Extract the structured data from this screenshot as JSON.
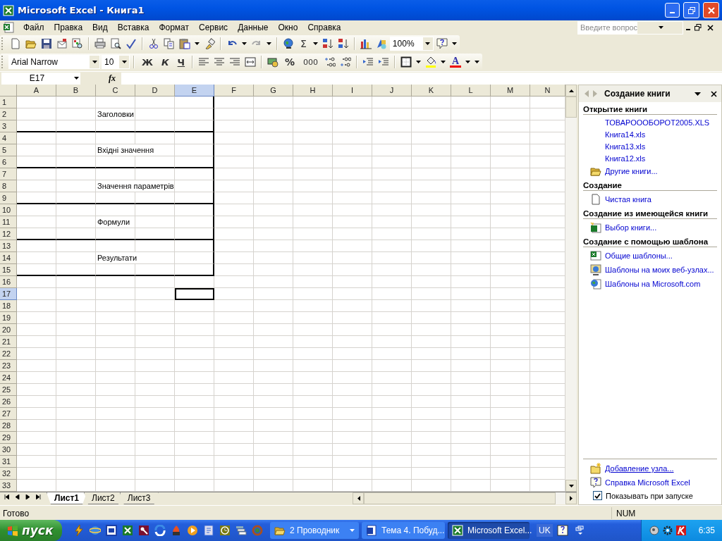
{
  "window": {
    "title": "Microsoft Excel - Книга1"
  },
  "menu": [
    "Файл",
    "Правка",
    "Вид",
    "Вставка",
    "Формат",
    "Сервис",
    "Данные",
    "Окно",
    "Справка"
  ],
  "help_box": {
    "placeholder": "Введите вопрос"
  },
  "standard_toolbar": {
    "sum_glyph": "Σ",
    "zoom": "100%"
  },
  "formatting_toolbar": {
    "font": "Arial Narrow",
    "size": "10",
    "bold": "Ж",
    "italic": "К",
    "underline": "Ч",
    "percent": "%",
    "thousands": "000",
    "font_color_glyph": "A"
  },
  "formula_bar": {
    "name_box": "E17",
    "function_glyph": "fx"
  },
  "sheet": {
    "columns": [
      {
        "label": "A",
        "selected": false,
        "outlined": true
      },
      {
        "label": "B",
        "selected": false,
        "outlined": true
      },
      {
        "label": "C",
        "selected": false,
        "outlined": true
      },
      {
        "label": "D",
        "selected": false,
        "outlined": true
      },
      {
        "label": "E",
        "selected": true,
        "outlined": true
      },
      {
        "label": "F",
        "selected": false,
        "outlined": false
      },
      {
        "label": "G",
        "selected": false,
        "outlined": false
      },
      {
        "label": "H",
        "selected": false,
        "outlined": false
      },
      {
        "label": "I",
        "selected": false,
        "outlined": false
      },
      {
        "label": "J",
        "selected": false,
        "outlined": false
      },
      {
        "label": "K",
        "selected": false,
        "outlined": false
      },
      {
        "label": "L",
        "selected": false,
        "outlined": false
      },
      {
        "label": "M",
        "selected": false,
        "outlined": false
      },
      {
        "label": "N",
        "selected": false,
        "outlined": false
      }
    ],
    "rows": [
      {
        "label": "1",
        "selected": false,
        "border_right": true,
        "border_bottom": false
      },
      {
        "label": "2",
        "selected": false,
        "border_right": true,
        "border_bottom": false,
        "cell_c": "Заголовки"
      },
      {
        "label": "3",
        "selected": false,
        "border_right": true,
        "border_bottom": true
      },
      {
        "label": "4",
        "selected": false,
        "border_right": true,
        "border_bottom": false
      },
      {
        "label": "5",
        "selected": false,
        "border_right": true,
        "border_bottom": false,
        "cell_c": "Вхідні значення"
      },
      {
        "label": "6",
        "selected": false,
        "border_right": true,
        "border_bottom": true
      },
      {
        "label": "7",
        "selected": false,
        "border_right": true,
        "border_bottom": false
      },
      {
        "label": "8",
        "selected": false,
        "border_right": true,
        "border_bottom": false,
        "cell_c": "Значення параметрів"
      },
      {
        "label": "9",
        "selected": false,
        "border_right": true,
        "border_bottom": true
      },
      {
        "label": "10",
        "selected": false,
        "border_right": true,
        "border_bottom": false
      },
      {
        "label": "11",
        "selected": false,
        "border_right": true,
        "border_bottom": false,
        "cell_c": "Формули"
      },
      {
        "label": "12",
        "selected": false,
        "border_right": true,
        "border_bottom": true
      },
      {
        "label": "13",
        "selected": false,
        "border_right": true,
        "border_bottom": false
      },
      {
        "label": "14",
        "selected": false,
        "border_right": true,
        "border_bottom": false,
        "cell_c": "Результати"
      },
      {
        "label": "15",
        "selected": false,
        "border_right": true,
        "border_bottom": true
      },
      {
        "label": "16",
        "selected": false,
        "border_right": false,
        "border_bottom": false
      },
      {
        "label": "17",
        "selected": true,
        "border_right": false,
        "border_bottom": false
      },
      {
        "label": "18",
        "selected": false,
        "border_right": false,
        "border_bottom": false
      },
      {
        "label": "19",
        "selected": false,
        "border_right": false,
        "border_bottom": false
      },
      {
        "label": "20",
        "selected": false,
        "border_right": false,
        "border_bottom": false
      },
      {
        "label": "21",
        "selected": false,
        "border_right": false,
        "border_bottom": false
      },
      {
        "label": "22",
        "selected": false,
        "border_right": false,
        "border_bottom": false
      },
      {
        "label": "23",
        "selected": false,
        "border_right": false,
        "border_bottom": false
      },
      {
        "label": "24",
        "selected": false,
        "border_right": false,
        "border_bottom": false
      },
      {
        "label": "25",
        "selected": false,
        "border_right": false,
        "border_bottom": false
      },
      {
        "label": "26",
        "selected": false,
        "border_right": false,
        "border_bottom": false
      },
      {
        "label": "27",
        "selected": false,
        "border_right": false,
        "border_bottom": false
      },
      {
        "label": "28",
        "selected": false,
        "border_right": false,
        "border_bottom": false
      },
      {
        "label": "29",
        "selected": false,
        "border_right": false,
        "border_bottom": false
      },
      {
        "label": "30",
        "selected": false,
        "border_right": false,
        "border_bottom": false
      },
      {
        "label": "31",
        "selected": false,
        "border_right": false,
        "border_bottom": false
      },
      {
        "label": "32",
        "selected": false,
        "border_right": false,
        "border_bottom": false
      },
      {
        "label": "33",
        "selected": false,
        "border_right": false,
        "border_bottom": false
      }
    ]
  },
  "sheet_tabs": [
    {
      "label": "Лист1",
      "selected": true
    },
    {
      "label": "Лист2",
      "selected": false
    },
    {
      "label": "Лист3",
      "selected": false
    }
  ],
  "task_pane": {
    "title": "Создание книги",
    "sections": [
      {
        "heading": "Открытие книги",
        "items": [
          {
            "label": "ТОВАРОООБОРОТ2005.XLS",
            "kind": "file"
          },
          {
            "label": "Книга14.xls",
            "kind": "file"
          },
          {
            "label": "Книга13.xls",
            "kind": "file"
          },
          {
            "label": "Книга12.xls",
            "kind": "file"
          },
          {
            "label": "Другие книги...",
            "kind": "folder"
          }
        ]
      },
      {
        "heading": "Создание",
        "items": [
          {
            "label": "Чистая книга",
            "kind": "page"
          }
        ]
      },
      {
        "heading": "Создание из имеющейся книги",
        "items": [
          {
            "label": "Выбор книги...",
            "kind": "spreadsheet"
          }
        ]
      },
      {
        "heading": "Создание с помощью шаблона",
        "items": [
          {
            "label": "Общие шаблоны...",
            "kind": "template"
          },
          {
            "label": "Шаблоны на моих веб-узлах...",
            "kind": "web"
          },
          {
            "label": "Шаблоны на Microsoft.com",
            "kind": "globe"
          }
        ]
      }
    ],
    "footer_links": [
      {
        "label": "Добавление узла...",
        "kind": "folder",
        "underlined": true
      },
      {
        "label": "Справка Microsoft Excel",
        "kind": "help",
        "underlined": false
      }
    ],
    "show_at_startup": {
      "label": "Показывать при запуске",
      "checked": true
    }
  },
  "status_bar": {
    "text": "Готово",
    "indicators": [
      "NUM"
    ]
  },
  "taskbar": {
    "start": "пуск",
    "tasks": [
      {
        "label": "2 Проводник",
        "kind": "folder",
        "selected": false,
        "has_menu": true
      },
      {
        "label": "Тема 4. Побуд...",
        "kind": "word",
        "selected": false,
        "has_menu": false
      },
      {
        "label": "Microsoft Excel...",
        "kind": "excel",
        "selected": true,
        "has_menu": false
      }
    ],
    "language": "UK",
    "clock": "6:35"
  }
}
